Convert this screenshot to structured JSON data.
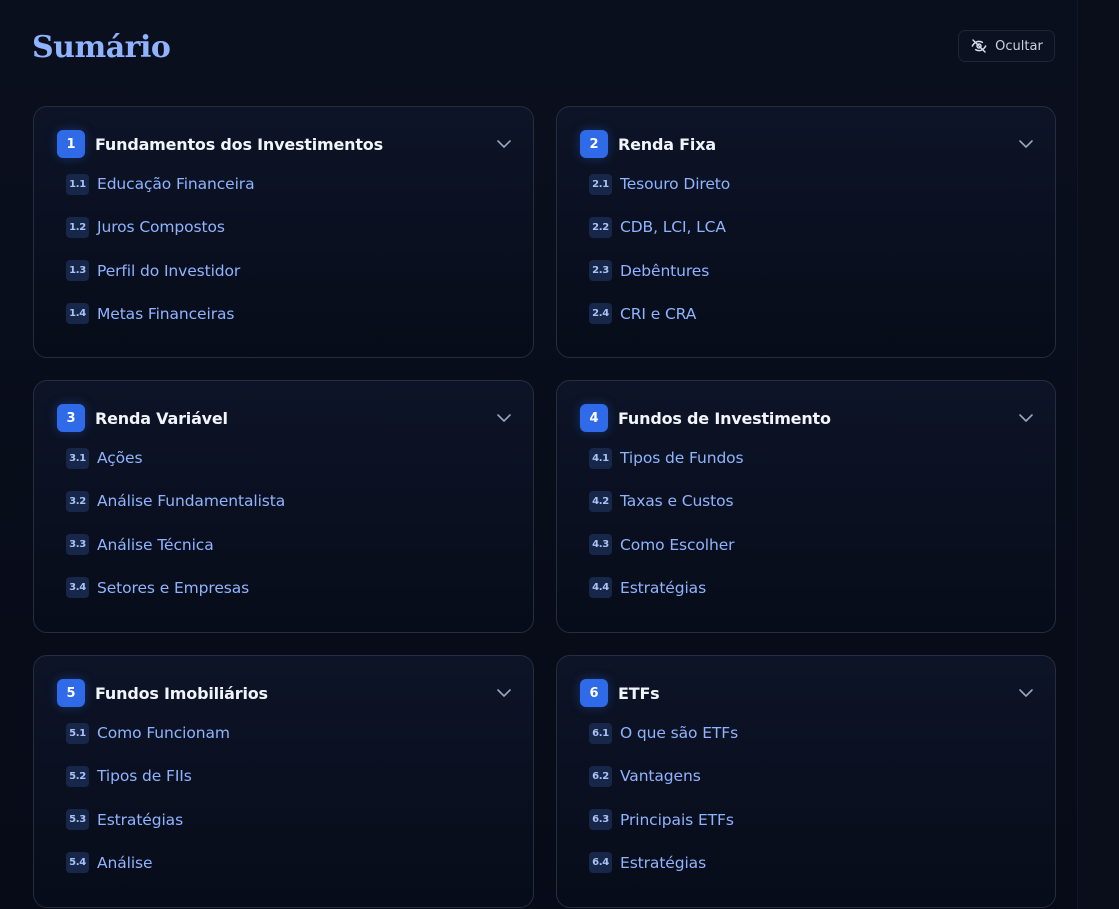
{
  "header": {
    "title": "Sumário",
    "hide_label": "Ocultar"
  },
  "sections": [
    {
      "number": "1",
      "title": "Fundamentos dos Investimentos",
      "items": [
        {
          "number": "1.1",
          "label": "Educação Financeira"
        },
        {
          "number": "1.2",
          "label": "Juros Compostos"
        },
        {
          "number": "1.3",
          "label": "Perfil do Investidor"
        },
        {
          "number": "1.4",
          "label": "Metas Financeiras"
        }
      ]
    },
    {
      "number": "2",
      "title": "Renda Fixa",
      "items": [
        {
          "number": "2.1",
          "label": "Tesouro Direto"
        },
        {
          "number": "2.2",
          "label": "CDB, LCI, LCA"
        },
        {
          "number": "2.3",
          "label": "Debêntures"
        },
        {
          "number": "2.4",
          "label": "CRI e CRA"
        }
      ]
    },
    {
      "number": "3",
      "title": "Renda Variável",
      "items": [
        {
          "number": "3.1",
          "label": "Ações"
        },
        {
          "number": "3.2",
          "label": "Análise Fundamentalista"
        },
        {
          "number": "3.3",
          "label": "Análise Técnica"
        },
        {
          "number": "3.4",
          "label": "Setores e Empresas"
        }
      ]
    },
    {
      "number": "4",
      "title": "Fundos de Investimento",
      "items": [
        {
          "number": "4.1",
          "label": "Tipos de Fundos"
        },
        {
          "number": "4.2",
          "label": "Taxas e Custos"
        },
        {
          "number": "4.3",
          "label": "Como Escolher"
        },
        {
          "number": "4.4",
          "label": "Estratégias"
        }
      ]
    },
    {
      "number": "5",
      "title": "Fundos Imobiliários",
      "items": [
        {
          "number": "5.1",
          "label": "Como Funcionam"
        },
        {
          "number": "5.2",
          "label": "Tipos de FIIs"
        },
        {
          "number": "5.3",
          "label": "Estratégias"
        },
        {
          "number": "5.4",
          "label": "Análise"
        }
      ]
    },
    {
      "number": "6",
      "title": "ETFs",
      "items": [
        {
          "number": "6.1",
          "label": "O que são ETFs"
        },
        {
          "number": "6.2",
          "label": "Vantagens"
        },
        {
          "number": "6.3",
          "label": "Principais ETFs"
        },
        {
          "number": "6.4",
          "label": "Estratégias"
        }
      ]
    }
  ],
  "icons": {
    "hide": "eye-off-icon",
    "expand": "chevron-down-icon"
  },
  "colors": {
    "accent": "#2f6ae8",
    "title": "#8fb3ff",
    "link": "#8fb3ff",
    "background": "#070b16"
  }
}
